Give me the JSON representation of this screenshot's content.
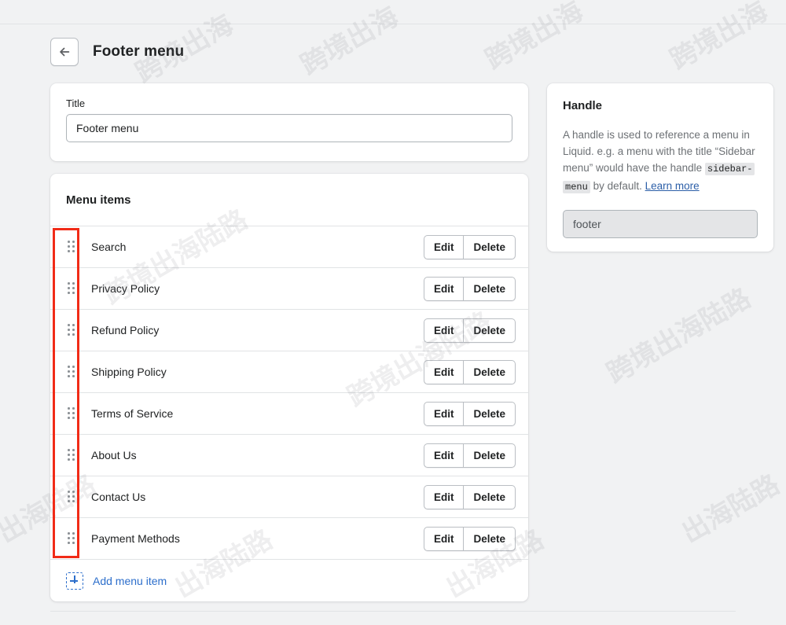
{
  "header": {
    "back_icon": "arrow-left-icon",
    "title": "Footer menu"
  },
  "title_card": {
    "label": "Title",
    "value": "Footer menu",
    "placeholder": "Footer menu"
  },
  "menu_items_card": {
    "heading": "Menu items",
    "edit_label": "Edit",
    "delete_label": "Delete",
    "drag_handle_icon": "drag-handle-icon",
    "items": [
      {
        "label": "Search"
      },
      {
        "label": "Privacy Policy"
      },
      {
        "label": "Refund Policy"
      },
      {
        "label": "Shipping Policy"
      },
      {
        "label": "Terms of Service"
      },
      {
        "label": "About Us"
      },
      {
        "label": "Contact Us"
      },
      {
        "label": "Payment Methods"
      }
    ],
    "add_item": {
      "icon": "add-square-icon",
      "label": "Add menu item"
    }
  },
  "handle_card": {
    "title": "Handle",
    "description_part1": "A handle is used to reference a menu in Liquid. e.g. a menu with the title “Sidebar menu” would have the handle ",
    "chip1": "sidebar-",
    "chip2": "menu",
    "description_part2": " by default. ",
    "learn_more_label": "Learn more",
    "input_value": "footer",
    "input_placeholder": "footer"
  },
  "annotation": {
    "color": "#f12b17",
    "target": "drag-handle-column"
  },
  "watermarks": [
    "跨境出海",
    "跨境出海陆路",
    "出海陆路"
  ]
}
